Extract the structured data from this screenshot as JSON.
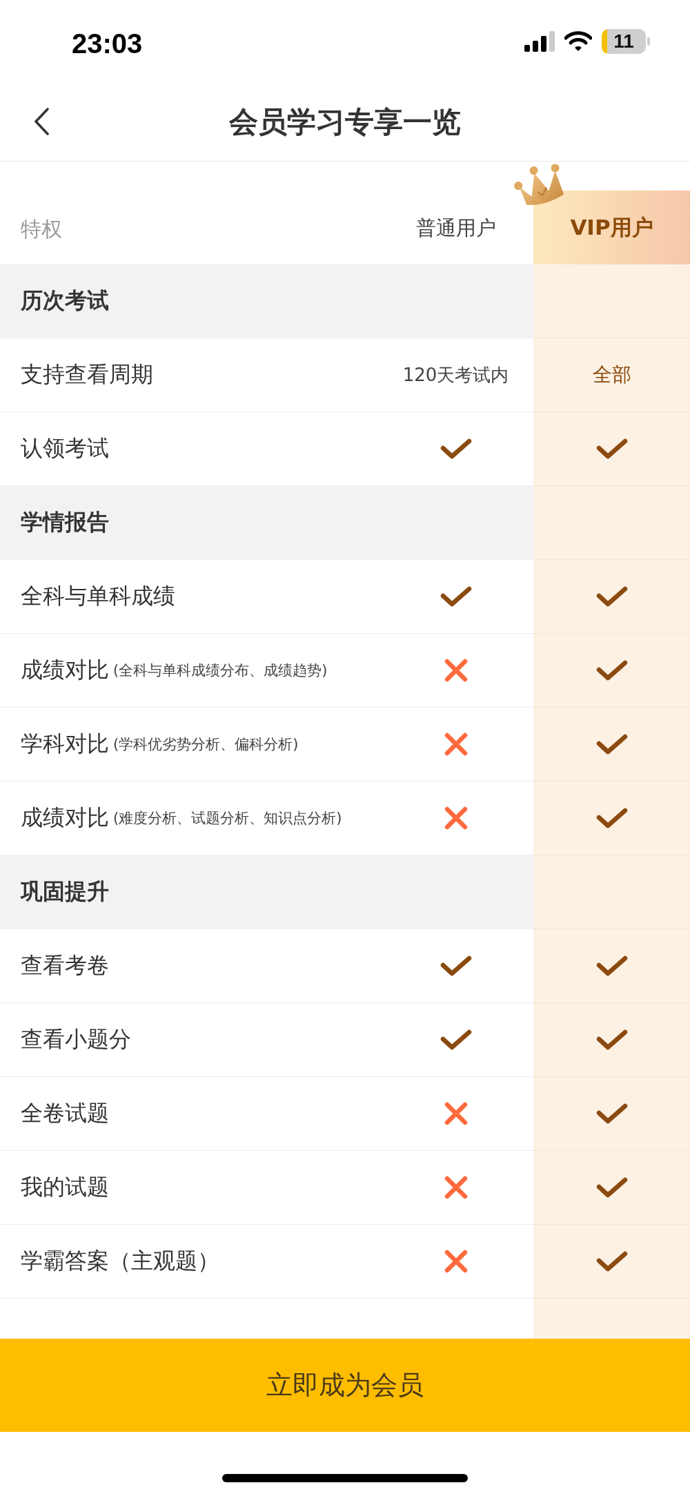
{
  "status_bar": {
    "time": "23:03",
    "battery": "11"
  },
  "nav": {
    "title": "会员学习专享一览"
  },
  "table": {
    "columns": [
      "特权",
      "普通用户",
      "VIP用户"
    ],
    "sections": [
      {
        "title": "历次考试",
        "items": [
          {
            "label": "支持查看周期",
            "normal": {
              "kind": "text",
              "text": "120天考试内"
            },
            "vip": {
              "kind": "text",
              "text": "全部"
            }
          },
          {
            "label": "认领考试",
            "normal": {
              "kind": "check"
            },
            "vip": {
              "kind": "check"
            }
          }
        ]
      },
      {
        "title": "学情报告",
        "items": [
          {
            "label": "全科与单科成绩",
            "normal": {
              "kind": "check"
            },
            "vip": {
              "kind": "check"
            }
          },
          {
            "label": "成绩对比",
            "note": "(全科与单科成绩分布、成绩趋势)",
            "normal": {
              "kind": "cross"
            },
            "vip": {
              "kind": "check"
            }
          },
          {
            "label": "学科对比",
            "note": "(学科优劣势分析、偏科分析)",
            "normal": {
              "kind": "cross"
            },
            "vip": {
              "kind": "check"
            }
          },
          {
            "label": "成绩对比",
            "note": "(难度分析、试题分析、知识点分析)",
            "normal": {
              "kind": "cross"
            },
            "vip": {
              "kind": "check"
            }
          }
        ]
      },
      {
        "title": "巩固提升",
        "items": [
          {
            "label": "查看考卷",
            "normal": {
              "kind": "check"
            },
            "vip": {
              "kind": "check"
            }
          },
          {
            "label": "查看小题分",
            "normal": {
              "kind": "check"
            },
            "vip": {
              "kind": "check"
            }
          },
          {
            "label": "全卷试题",
            "normal": {
              "kind": "cross"
            },
            "vip": {
              "kind": "check"
            }
          },
          {
            "label": "我的试题",
            "normal": {
              "kind": "cross"
            },
            "vip": {
              "kind": "check"
            }
          },
          {
            "label": "学霸答案（主观题）",
            "normal": {
              "kind": "cross"
            },
            "vip": {
              "kind": "check"
            }
          }
        ]
      }
    ]
  },
  "cta": {
    "label": "立即成为会员"
  }
}
